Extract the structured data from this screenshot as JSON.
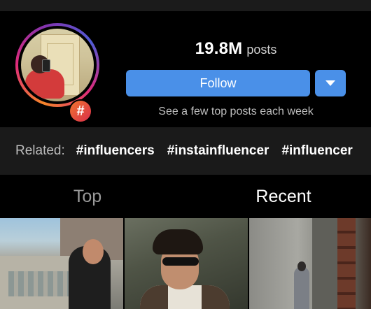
{
  "hashtag": {
    "post_count": "19.8M",
    "post_count_unit": "posts",
    "follow_label": "Follow",
    "note": "See a few top posts each week",
    "badge_symbol": "#"
  },
  "related": {
    "label": "Related:",
    "tags": [
      "#influencers",
      "#instainfluencer",
      "#influencer"
    ]
  },
  "tabs": [
    {
      "label": "Top",
      "active": false
    },
    {
      "label": "Recent",
      "active": true
    }
  ],
  "colors": {
    "accent": "#4a90e8",
    "background": "#000000",
    "panel": "#1a1a1a",
    "inactive_text": "#9a9a9a"
  }
}
